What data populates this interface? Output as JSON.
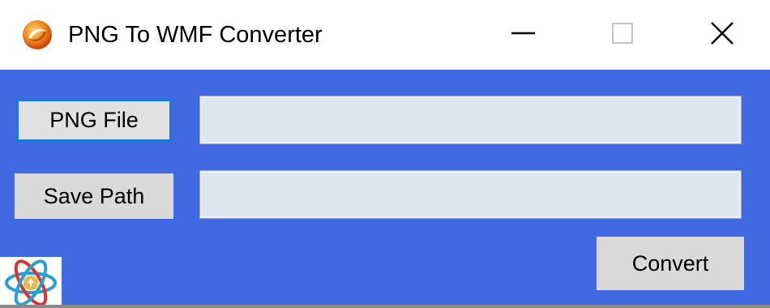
{
  "window": {
    "title": "PNG To WMF Converter",
    "icon": "orange-swirl-app-icon",
    "controls": {
      "minimize_icon": "minimize-icon",
      "maximize_icon": "maximize-icon",
      "close_icon": "close-icon"
    }
  },
  "form": {
    "png_file_button": "PNG File",
    "png_file_value": "",
    "save_path_button": "Save Path",
    "save_path_value": "",
    "convert_button": "Convert"
  },
  "footer": {
    "logo_icon": "atom-logo-icon"
  },
  "colors": {
    "client_background": "#4169e1",
    "button_face": "#d9d9d9",
    "field_background": "#dce6f1",
    "focus_border": "#1e78d7"
  }
}
